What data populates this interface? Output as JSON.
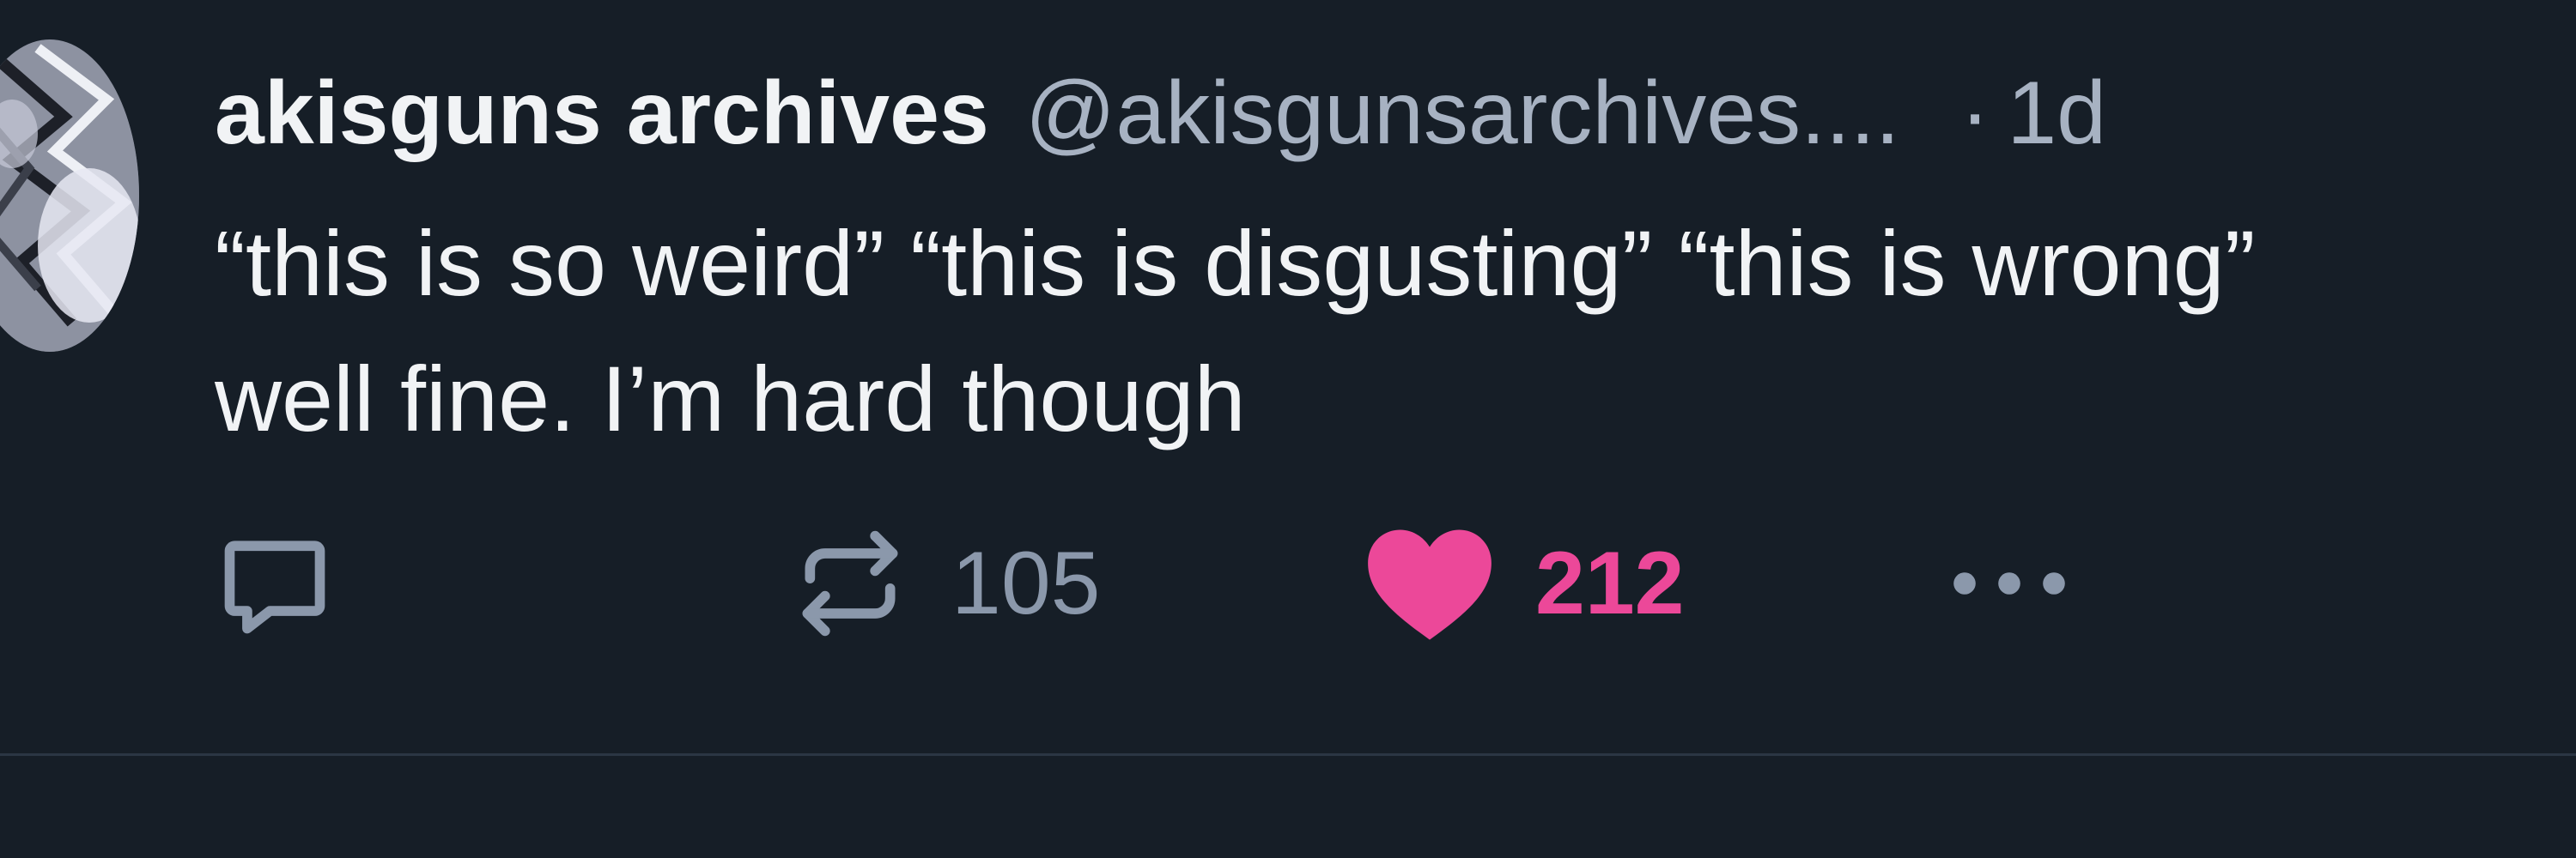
{
  "post": {
    "author": {
      "display_name": "akisguns archives",
      "handle": "@akisgunsarchives....",
      "avatar": "avatar-image"
    },
    "timestamp_separator": "·",
    "timestamp": "1d",
    "text": "“this is so weird” “this is disgusting” “this is wrong” well fine. I’m hard though",
    "actions": {
      "reply": {
        "icon": "reply-icon"
      },
      "repost": {
        "icon": "repost-icon",
        "count": "105"
      },
      "like": {
        "icon": "heart-icon",
        "count": "212",
        "liked": true
      },
      "more": {
        "icon": "more-icon"
      }
    }
  },
  "colors": {
    "background": "#161e27",
    "primary_text": "#f1f3f5",
    "secondary_text": "#a7b2c2",
    "icon_muted": "#8b98ab",
    "like_accent": "#ec4899",
    "divider": "#2b3644"
  }
}
